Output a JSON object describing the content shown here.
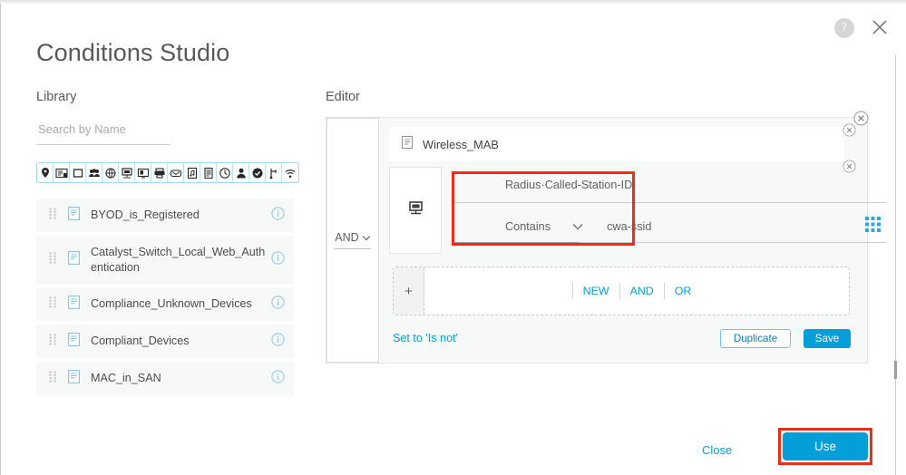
{
  "dialog": {
    "title": "Conditions Studio",
    "help_icon": "help-circle-icon",
    "close_icon": "close-x-icon"
  },
  "library": {
    "heading": "Library",
    "search": {
      "placeholder": "Search by Name",
      "value": ""
    },
    "filter_icons": [
      "location-pin-icon",
      "form-card-icon",
      "square-outline-icon",
      "people-group-icon",
      "globe-icon",
      "desktop-network-icon",
      "monitor-card-icon",
      "printer-icon",
      "envelope-icon",
      "note-music-icon",
      "server-rack-icon",
      "clock-icon",
      "person-icon",
      "check-circle-icon",
      "branch-icon",
      "wifi-icon"
    ],
    "items": [
      {
        "label": "BYOD_is_Registered",
        "icon": "condition-doc-icon",
        "info": "info-icon"
      },
      {
        "label": "Catalyst_Switch_Local_Web_Authentication",
        "icon": "condition-doc-icon",
        "info": "info-icon"
      },
      {
        "label": "Compliance_Unknown_Devices",
        "icon": "condition-doc-icon",
        "info": "info-icon"
      },
      {
        "label": "Compliant_Devices",
        "icon": "condition-doc-icon",
        "info": "info-icon"
      },
      {
        "label": "MAC_in_SAN",
        "icon": "condition-doc-icon",
        "info": "info-icon"
      }
    ]
  },
  "editor": {
    "heading": "Editor",
    "logic_operator": "AND",
    "blocks": [
      {
        "type": "library_reference",
        "label": "Wireless_MAB",
        "icon": "condition-doc-icon"
      }
    ],
    "condition": {
      "device_icon": "desktop-network-icon",
      "attribute": "Radius·Called-Station-ID",
      "operator": "Contains",
      "value": "cwa-ssid",
      "picker_icon": "grid-apps-icon"
    },
    "add_row": {
      "plus_label": "+",
      "buttons": [
        "NEW",
        "AND",
        "OR"
      ]
    },
    "footer": {
      "is_not_link": "Set to 'Is not'",
      "duplicate_label": "Duplicate",
      "save_label": "Save"
    }
  },
  "footer": {
    "close_label": "Close",
    "use_label": "Use"
  },
  "annotations": {
    "highlight_color": "#ef2d17",
    "boxes": [
      "condition-attribute-operator",
      "use-button"
    ]
  },
  "colors": {
    "accent_blue": "#049fd9",
    "panel_bg": "#f7f8f8",
    "text": "#4a4c4e",
    "highlight_red": "#ef2d17"
  }
}
